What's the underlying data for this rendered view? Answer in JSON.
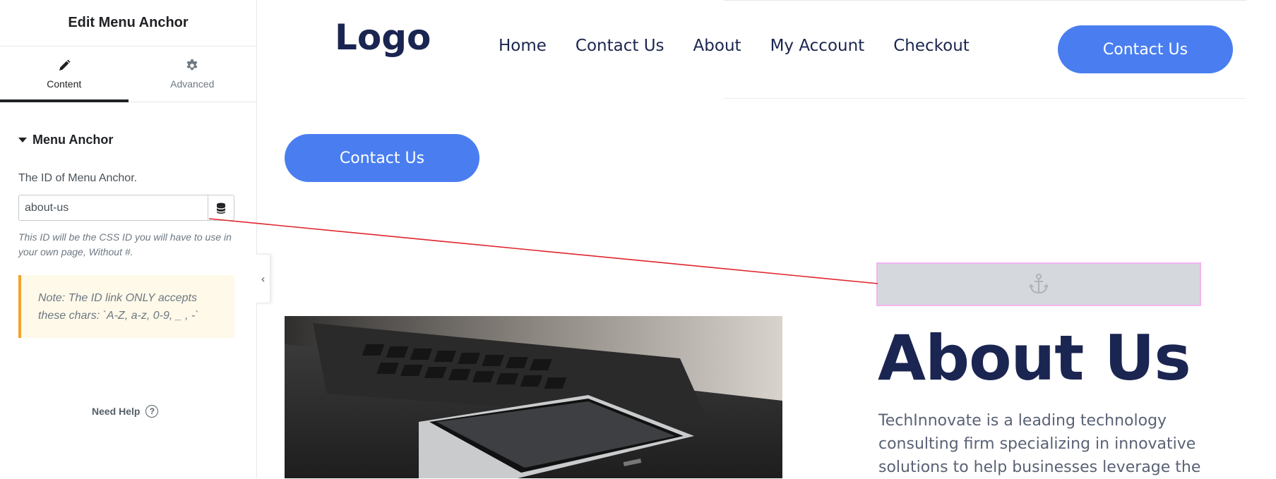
{
  "panel": {
    "title": "Edit Menu Anchor",
    "tabs": [
      {
        "label": "Content",
        "icon": "pencil-icon",
        "active": true
      },
      {
        "label": "Advanced",
        "icon": "gear-icon",
        "active": false
      }
    ],
    "section": {
      "title": "Menu Anchor",
      "expanded": true
    },
    "field": {
      "label": "The ID of Menu Anchor.",
      "value": "about-us",
      "dynamic_icon": "database-icon"
    },
    "help_text": "This ID will be the CSS ID you will have to use in your own page, Without #.",
    "note": "Note: The ID link ONLY accepts these chars: `A-Z, a-z, 0-9, _ , -`",
    "need_help": {
      "label": "Need Help",
      "icon": "question-circle-icon"
    },
    "collapse_icon": "chevron-left-icon"
  },
  "preview": {
    "logo": "Logo",
    "nav": [
      "Home",
      "Contact Us",
      "About",
      "My Account",
      "Checkout"
    ],
    "header_button": "Contact Us",
    "body_button": "Contact Us",
    "anchor_icon": "anchor-icon",
    "about": {
      "heading": "About Us",
      "text": "TechInnovate is a leading technology consulting firm specializing in innovative solutions to help businesses leverage the"
    },
    "colors": {
      "primary_button": "#4a7ef0",
      "heading": "#1b2551",
      "anchor_outline": "#f1b6f0",
      "connector_line": "#e0242c",
      "note_border": "#f0a32c"
    }
  }
}
